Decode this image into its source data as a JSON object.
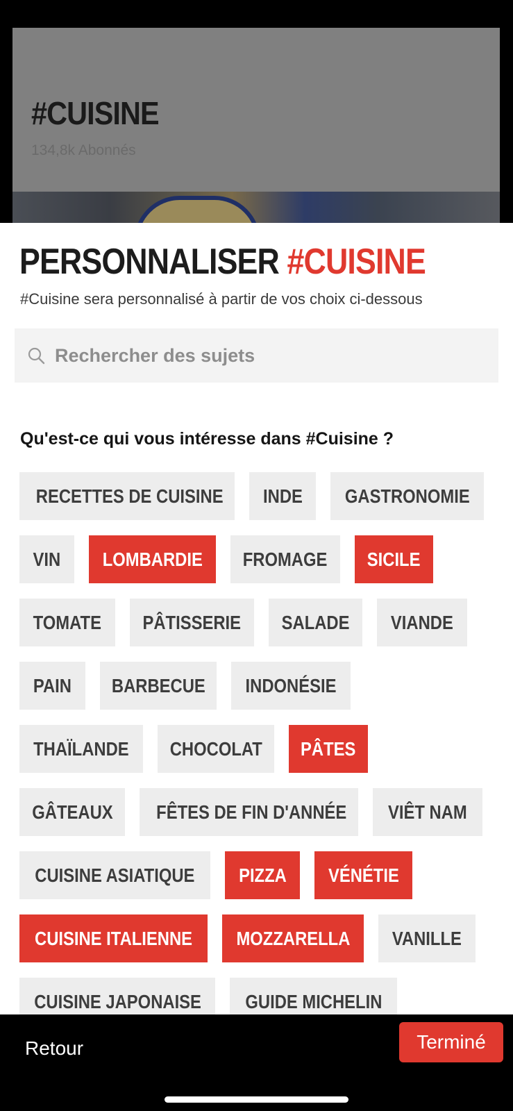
{
  "background_card": {
    "title": "#CUISINE",
    "subtitle": "134,8k Abonnés"
  },
  "sheet": {
    "title_prefix": "PERSONNALISER ",
    "title_accent": "#CUISINE",
    "subtitle": "#Cuisine sera personnalisé à partir de vos choix ci-dessous",
    "search_placeholder": "Rechercher des sujets",
    "search_icon": "search-icon",
    "question": "Qu'est-ce qui vous intéresse dans #Cuisine ?",
    "accent_color": "#e0392f",
    "chips": [
      {
        "label": "RECETTES DE CUISINE",
        "selected": false
      },
      {
        "label": "INDE",
        "selected": false
      },
      {
        "label": "GASTRONOMIE",
        "selected": false
      },
      {
        "label": "VIN",
        "selected": false
      },
      {
        "label": "LOMBARDIE",
        "selected": true
      },
      {
        "label": "FROMAGE",
        "selected": false
      },
      {
        "label": "SICILE",
        "selected": true
      },
      {
        "label": "TOMATE",
        "selected": false
      },
      {
        "label": "PÂTISSERIE",
        "selected": false
      },
      {
        "label": "SALADE",
        "selected": false
      },
      {
        "label": "VIANDE",
        "selected": false
      },
      {
        "label": "PAIN",
        "selected": false
      },
      {
        "label": "BARBECUE",
        "selected": false
      },
      {
        "label": "INDONÉSIE",
        "selected": false
      },
      {
        "label": "THAÏLANDE",
        "selected": false
      },
      {
        "label": "CHOCOLAT",
        "selected": false
      },
      {
        "label": "PÂTES",
        "selected": true
      },
      {
        "label": "GÂTEAUX",
        "selected": false
      },
      {
        "label": "FÊTES DE FIN D'ANNÉE",
        "selected": false
      },
      {
        "label": "VIÊT NAM",
        "selected": false
      },
      {
        "label": "CUISINE ASIATIQUE",
        "selected": false
      },
      {
        "label": "PIZZA",
        "selected": true
      },
      {
        "label": "VÉNÉTIE",
        "selected": true
      },
      {
        "label": "CUISINE ITALIENNE",
        "selected": true
      },
      {
        "label": "MOZZARELLA",
        "selected": true
      },
      {
        "label": "VANILLE",
        "selected": false
      },
      {
        "label": "CUISINE JAPONAISE",
        "selected": false
      },
      {
        "label": "GUIDE MICHELIN",
        "selected": false
      }
    ]
  },
  "footer": {
    "back_label": "Retour",
    "done_label": "Terminé"
  }
}
